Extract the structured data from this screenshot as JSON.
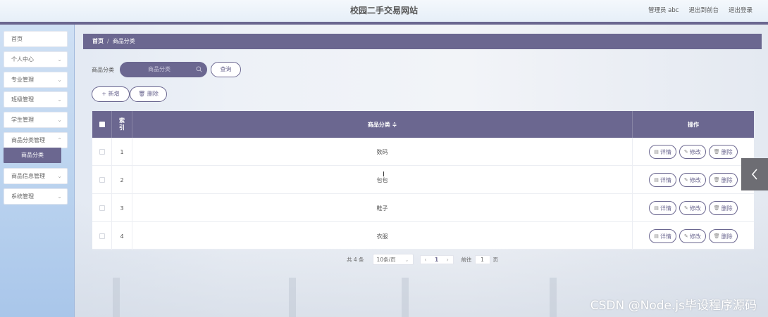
{
  "header": {
    "site_title": "校园二手交易网站",
    "user_label": "管理员 abc",
    "front_link": "退出到前台",
    "logout_link": "退出登录"
  },
  "sidebar": {
    "items": [
      {
        "label": "首页",
        "has_chevron": false
      },
      {
        "label": "个人中心",
        "has_chevron": true
      },
      {
        "label": "专业管理",
        "has_chevron": true
      },
      {
        "label": "班级管理",
        "has_chevron": true
      },
      {
        "label": "学生管理",
        "has_chevron": true
      },
      {
        "label": "商品分类管理",
        "has_chevron": true
      },
      {
        "label": "商品信息管理",
        "has_chevron": true
      },
      {
        "label": "系统管理",
        "has_chevron": true
      }
    ],
    "active_sub": "商品分类"
  },
  "breadcrumb": {
    "home": "首页",
    "separator": "/",
    "current": "商品分类"
  },
  "search": {
    "label": "商品分类",
    "placeholder": "商品分类",
    "query_button": "查询"
  },
  "actions": {
    "add": "+ 新增",
    "delete": "删除"
  },
  "table": {
    "headers": {
      "index": "索引",
      "category": "商品分类 ≑",
      "ops": "操作"
    },
    "rows": [
      {
        "index": "1",
        "category": "数码"
      },
      {
        "index": "2",
        "category": "包包"
      },
      {
        "index": "3",
        "category": "鞋子"
      },
      {
        "index": "4",
        "category": "衣服"
      }
    ],
    "row_buttons": {
      "detail": "详情",
      "edit": "修改",
      "delete": "删除"
    }
  },
  "pagination": {
    "total": "共 4 条",
    "page_size": "10条/页",
    "current_page": "1",
    "goto_label": "前往",
    "goto_value": "1",
    "page_unit": "页"
  },
  "watermark": "CSDN @Node.js毕设程序源码",
  "colors": {
    "primary": "#6b6790",
    "header_bg": "#eef4fa",
    "sidebar_bg": "#bcd4ef"
  }
}
